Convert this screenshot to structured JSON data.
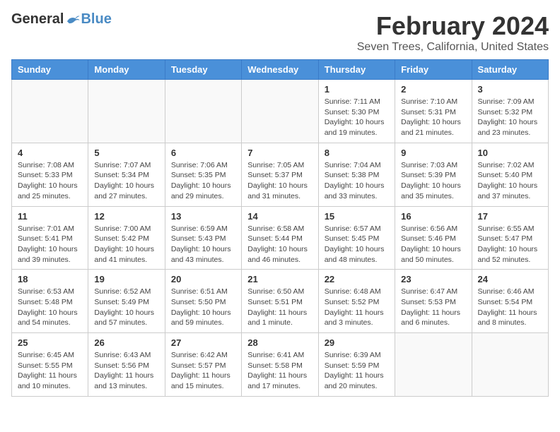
{
  "header": {
    "logo_general": "General",
    "logo_blue": "Blue",
    "month_title": "February 2024",
    "location": "Seven Trees, California, United States"
  },
  "days_of_week": [
    "Sunday",
    "Monday",
    "Tuesday",
    "Wednesday",
    "Thursday",
    "Friday",
    "Saturday"
  ],
  "weeks": [
    [
      {
        "day": "",
        "info": ""
      },
      {
        "day": "",
        "info": ""
      },
      {
        "day": "",
        "info": ""
      },
      {
        "day": "",
        "info": ""
      },
      {
        "day": "1",
        "info": "Sunrise: 7:11 AM\nSunset: 5:30 PM\nDaylight: 10 hours\nand 19 minutes."
      },
      {
        "day": "2",
        "info": "Sunrise: 7:10 AM\nSunset: 5:31 PM\nDaylight: 10 hours\nand 21 minutes."
      },
      {
        "day": "3",
        "info": "Sunrise: 7:09 AM\nSunset: 5:32 PM\nDaylight: 10 hours\nand 23 minutes."
      }
    ],
    [
      {
        "day": "4",
        "info": "Sunrise: 7:08 AM\nSunset: 5:33 PM\nDaylight: 10 hours\nand 25 minutes."
      },
      {
        "day": "5",
        "info": "Sunrise: 7:07 AM\nSunset: 5:34 PM\nDaylight: 10 hours\nand 27 minutes."
      },
      {
        "day": "6",
        "info": "Sunrise: 7:06 AM\nSunset: 5:35 PM\nDaylight: 10 hours\nand 29 minutes."
      },
      {
        "day": "7",
        "info": "Sunrise: 7:05 AM\nSunset: 5:37 PM\nDaylight: 10 hours\nand 31 minutes."
      },
      {
        "day": "8",
        "info": "Sunrise: 7:04 AM\nSunset: 5:38 PM\nDaylight: 10 hours\nand 33 minutes."
      },
      {
        "day": "9",
        "info": "Sunrise: 7:03 AM\nSunset: 5:39 PM\nDaylight: 10 hours\nand 35 minutes."
      },
      {
        "day": "10",
        "info": "Sunrise: 7:02 AM\nSunset: 5:40 PM\nDaylight: 10 hours\nand 37 minutes."
      }
    ],
    [
      {
        "day": "11",
        "info": "Sunrise: 7:01 AM\nSunset: 5:41 PM\nDaylight: 10 hours\nand 39 minutes."
      },
      {
        "day": "12",
        "info": "Sunrise: 7:00 AM\nSunset: 5:42 PM\nDaylight: 10 hours\nand 41 minutes."
      },
      {
        "day": "13",
        "info": "Sunrise: 6:59 AM\nSunset: 5:43 PM\nDaylight: 10 hours\nand 43 minutes."
      },
      {
        "day": "14",
        "info": "Sunrise: 6:58 AM\nSunset: 5:44 PM\nDaylight: 10 hours\nand 46 minutes."
      },
      {
        "day": "15",
        "info": "Sunrise: 6:57 AM\nSunset: 5:45 PM\nDaylight: 10 hours\nand 48 minutes."
      },
      {
        "day": "16",
        "info": "Sunrise: 6:56 AM\nSunset: 5:46 PM\nDaylight: 10 hours\nand 50 minutes."
      },
      {
        "day": "17",
        "info": "Sunrise: 6:55 AM\nSunset: 5:47 PM\nDaylight: 10 hours\nand 52 minutes."
      }
    ],
    [
      {
        "day": "18",
        "info": "Sunrise: 6:53 AM\nSunset: 5:48 PM\nDaylight: 10 hours\nand 54 minutes."
      },
      {
        "day": "19",
        "info": "Sunrise: 6:52 AM\nSunset: 5:49 PM\nDaylight: 10 hours\nand 57 minutes."
      },
      {
        "day": "20",
        "info": "Sunrise: 6:51 AM\nSunset: 5:50 PM\nDaylight: 10 hours\nand 59 minutes."
      },
      {
        "day": "21",
        "info": "Sunrise: 6:50 AM\nSunset: 5:51 PM\nDaylight: 11 hours\nand 1 minute."
      },
      {
        "day": "22",
        "info": "Sunrise: 6:48 AM\nSunset: 5:52 PM\nDaylight: 11 hours\nand 3 minutes."
      },
      {
        "day": "23",
        "info": "Sunrise: 6:47 AM\nSunset: 5:53 PM\nDaylight: 11 hours\nand 6 minutes."
      },
      {
        "day": "24",
        "info": "Sunrise: 6:46 AM\nSunset: 5:54 PM\nDaylight: 11 hours\nand 8 minutes."
      }
    ],
    [
      {
        "day": "25",
        "info": "Sunrise: 6:45 AM\nSunset: 5:55 PM\nDaylight: 11 hours\nand 10 minutes."
      },
      {
        "day": "26",
        "info": "Sunrise: 6:43 AM\nSunset: 5:56 PM\nDaylight: 11 hours\nand 13 minutes."
      },
      {
        "day": "27",
        "info": "Sunrise: 6:42 AM\nSunset: 5:57 PM\nDaylight: 11 hours\nand 15 minutes."
      },
      {
        "day": "28",
        "info": "Sunrise: 6:41 AM\nSunset: 5:58 PM\nDaylight: 11 hours\nand 17 minutes."
      },
      {
        "day": "29",
        "info": "Sunrise: 6:39 AM\nSunset: 5:59 PM\nDaylight: 11 hours\nand 20 minutes."
      },
      {
        "day": "",
        "info": ""
      },
      {
        "day": "",
        "info": ""
      }
    ]
  ]
}
